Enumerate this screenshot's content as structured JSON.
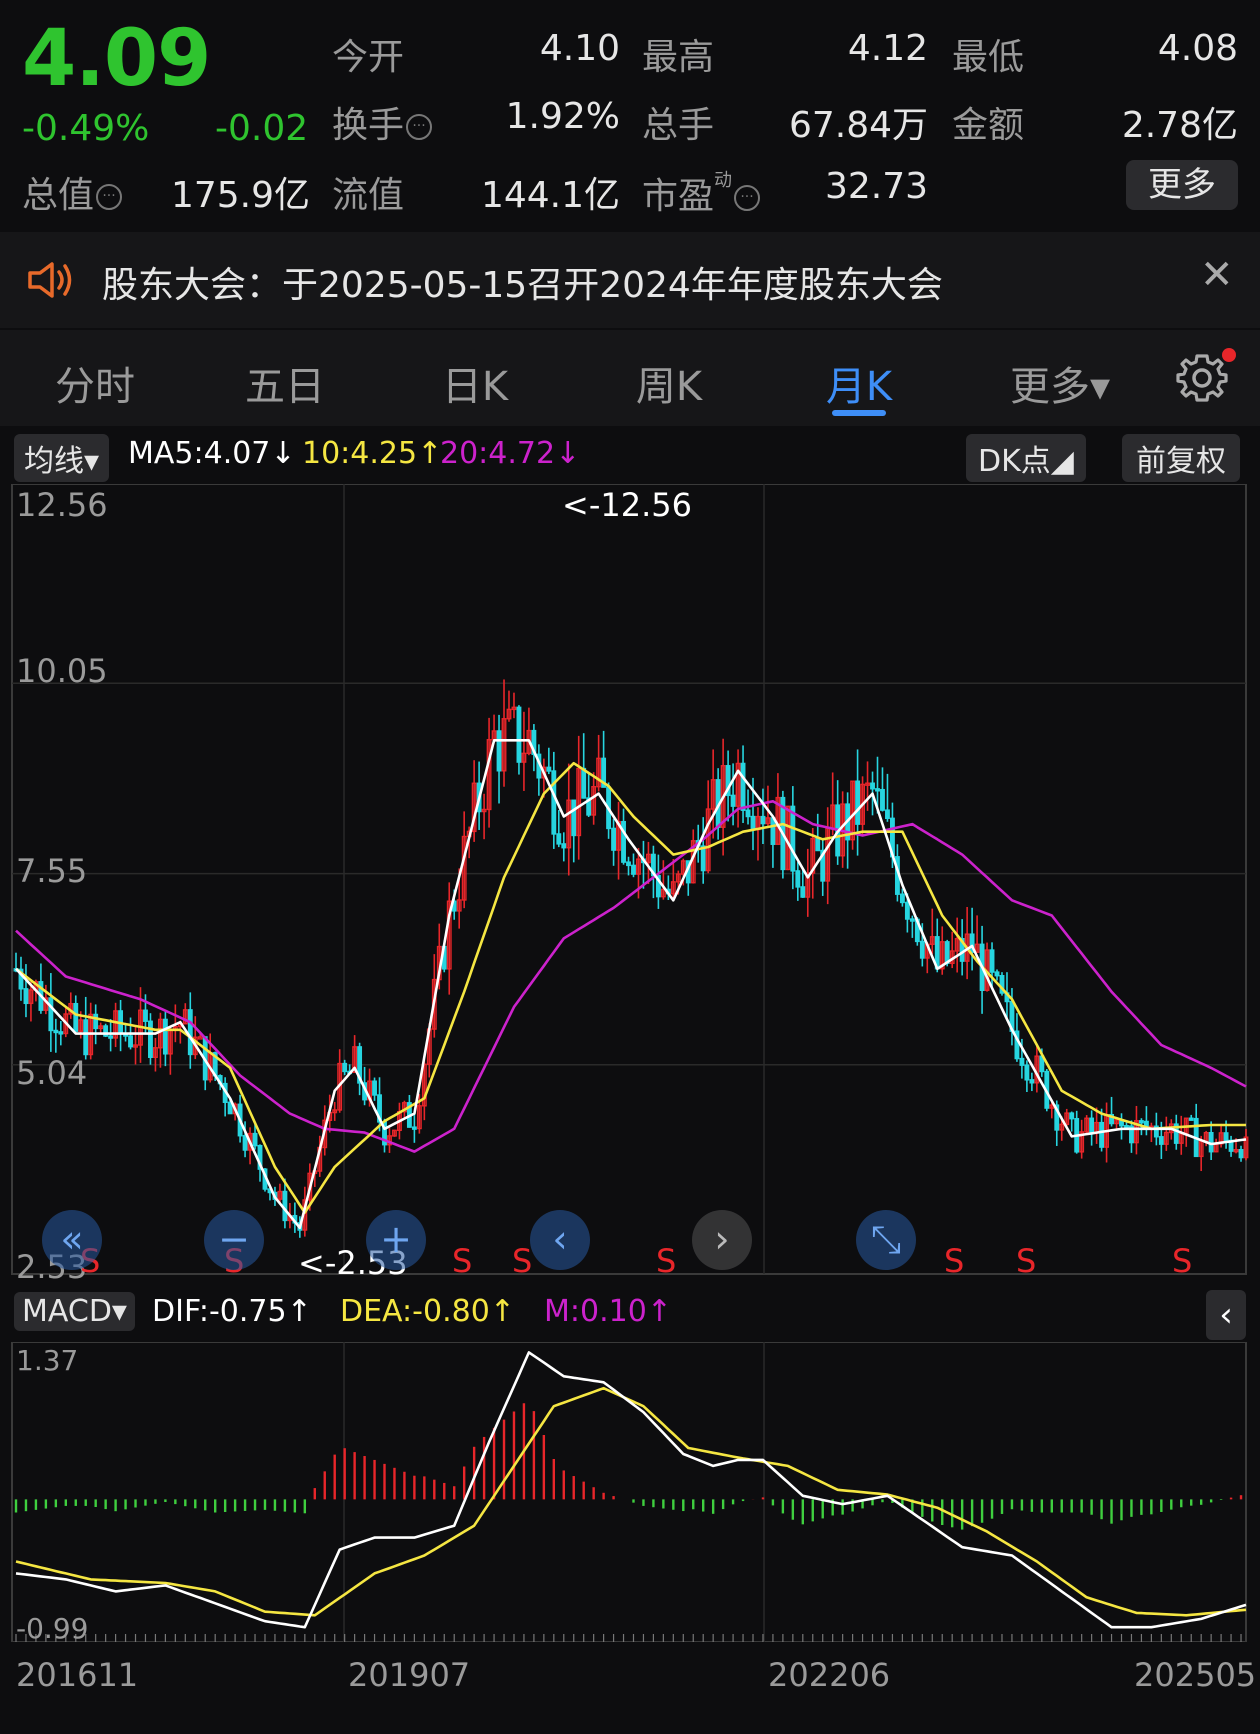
{
  "quote": {
    "price": "4.09",
    "change_pct": "-0.49%",
    "change": "-0.02",
    "open_label": "今开",
    "open": "4.10",
    "high_label": "最高",
    "high": "4.12",
    "low_label": "最低",
    "low": "4.08",
    "turnover_label": "换手",
    "turnover": "1.92%",
    "volume_label": "总手",
    "volume": "67.84万",
    "amount_label": "金额",
    "amount": "2.78亿",
    "mktcap_label": "总值",
    "mktcap": "175.9亿",
    "float_label": "流值",
    "float": "144.1亿",
    "pe_label": "市盈",
    "pe_sup": "动",
    "pe": "32.73",
    "more_label": "更多"
  },
  "notice": {
    "text": "股东大会：于2025-05-15召开2024年年度股东大会",
    "close": "✕"
  },
  "tabs": [
    {
      "label": "分时"
    },
    {
      "label": "五日"
    },
    {
      "label": "日K"
    },
    {
      "label": "周K"
    },
    {
      "label": "月K"
    },
    {
      "label": "更多▾"
    }
  ],
  "ma_bar": {
    "selector": "均线▾",
    "ma5": "MA5:4.07↓",
    "ma10": "10:4.25↑",
    "ma20": "20:4.72↓",
    "dk": "DK点◢",
    "adjust": "前复权"
  },
  "kline_axis": {
    "y_labels": [
      "12.56",
      "10.05",
      "7.55",
      "5.04",
      "2.53"
    ],
    "max_marker": "<-12.56",
    "min_marker": "<-2.53",
    "s_label": "S"
  },
  "macd_bar": {
    "selector": "MACD▾",
    "dif": "DIF:-0.75↑",
    "dea": "DEA:-0.80↑",
    "m": "M:0.10↑",
    "y_max": "1.37",
    "y_min": "-0.99"
  },
  "x_axis": [
    "201611",
    "201907",
    "202206",
    "202505"
  ],
  "colors": {
    "up": "#e8262a",
    "down": "#27d5e0",
    "ma5": "#ffffff",
    "ma10": "#f5e642",
    "ma20": "#cc22cc",
    "accent": "#3e8ef7"
  },
  "chart_data": {
    "type": "candlestick",
    "y_range": [
      2.53,
      12.56
    ],
    "ma5_knots": [
      [
        0,
        6.3
      ],
      [
        12,
        5.45
      ],
      [
        28,
        5.45
      ],
      [
        33,
        5.6
      ],
      [
        43,
        4.6
      ],
      [
        52,
        3.3
      ],
      [
        57,
        2.9
      ],
      [
        64,
        4.7
      ],
      [
        68,
        5.0
      ],
      [
        74,
        4.2
      ],
      [
        80,
        4.4
      ],
      [
        87,
        7.0
      ],
      [
        96,
        9.3
      ],
      [
        103,
        9.3
      ],
      [
        110,
        8.3
      ],
      [
        117,
        8.6
      ],
      [
        123,
        8.0
      ],
      [
        132,
        7.2
      ],
      [
        139,
        8.2
      ],
      [
        145,
        8.9
      ],
      [
        152,
        8.3
      ],
      [
        159,
        7.5
      ],
      [
        165,
        8.1
      ],
      [
        172,
        8.6
      ],
      [
        178,
        7.4
      ],
      [
        185,
        6.3
      ],
      [
        192,
        6.6
      ],
      [
        200,
        5.5
      ],
      [
        212,
        4.1
      ],
      [
        222,
        4.2
      ],
      [
        232,
        4.2
      ],
      [
        240,
        4.0
      ],
      [
        248,
        4.07
      ]
    ],
    "ma10_knots": [
      [
        0,
        6.3
      ],
      [
        12,
        5.7
      ],
      [
        28,
        5.5
      ],
      [
        33,
        5.5
      ],
      [
        43,
        5.0
      ],
      [
        52,
        3.7
      ],
      [
        58,
        3.1
      ],
      [
        64,
        3.7
      ],
      [
        74,
        4.3
      ],
      [
        82,
        4.6
      ],
      [
        90,
        6.0
      ],
      [
        98,
        7.5
      ],
      [
        106,
        8.6
      ],
      [
        112,
        9.0
      ],
      [
        119,
        8.7
      ],
      [
        124,
        8.3
      ],
      [
        132,
        7.8
      ],
      [
        139,
        7.9
      ],
      [
        146,
        8.1
      ],
      [
        154,
        8.2
      ],
      [
        162,
        8.0
      ],
      [
        170,
        8.1
      ],
      [
        178,
        8.1
      ],
      [
        186,
        7.0
      ],
      [
        193,
        6.4
      ],
      [
        200,
        5.9
      ],
      [
        210,
        4.7
      ],
      [
        218,
        4.4
      ],
      [
        228,
        4.2
      ],
      [
        240,
        4.25
      ],
      [
        248,
        4.25
      ]
    ],
    "ma20_knots": [
      [
        0,
        6.8
      ],
      [
        10,
        6.2
      ],
      [
        25,
        5.9
      ],
      [
        35,
        5.6
      ],
      [
        45,
        4.9
      ],
      [
        55,
        4.4
      ],
      [
        62,
        4.2
      ],
      [
        70,
        4.15
      ],
      [
        80,
        3.9
      ],
      [
        88,
        4.2
      ],
      [
        100,
        5.8
      ],
      [
        110,
        6.7
      ],
      [
        120,
        7.1
      ],
      [
        130,
        7.6
      ],
      [
        138,
        8.0
      ],
      [
        145,
        8.4
      ],
      [
        152,
        8.5
      ],
      [
        160,
        8.2
      ],
      [
        170,
        8.05
      ],
      [
        180,
        8.2
      ],
      [
        190,
        7.8
      ],
      [
        200,
        7.2
      ],
      [
        208,
        7.0
      ],
      [
        220,
        6.0
      ],
      [
        230,
        5.3
      ],
      [
        240,
        5.0
      ],
      [
        248,
        4.72
      ]
    ],
    "candle_months": 248,
    "macd": {
      "y_range": [
        -0.99,
        1.37
      ],
      "dif_knots": [
        [
          0,
          -0.5
        ],
        [
          10,
          -0.55
        ],
        [
          20,
          -0.65
        ],
        [
          30,
          -0.6
        ],
        [
          40,
          -0.75
        ],
        [
          50,
          -0.9
        ],
        [
          58,
          -0.95
        ],
        [
          65,
          -0.3
        ],
        [
          72,
          -0.2
        ],
        [
          80,
          -0.2
        ],
        [
          88,
          -0.1
        ],
        [
          95,
          0.6
        ],
        [
          103,
          1.35
        ],
        [
          110,
          1.15
        ],
        [
          118,
          1.1
        ],
        [
          126,
          0.85
        ],
        [
          134,
          0.5
        ],
        [
          140,
          0.4
        ],
        [
          145,
          0.45
        ],
        [
          150,
          0.45
        ],
        [
          158,
          0.15
        ],
        [
          166,
          0.08
        ],
        [
          175,
          0.15
        ],
        [
          182,
          -0.05
        ],
        [
          190,
          -0.28
        ],
        [
          200,
          -0.35
        ],
        [
          210,
          -0.65
        ],
        [
          220,
          -0.95
        ],
        [
          228,
          -0.95
        ],
        [
          238,
          -0.88
        ],
        [
          248,
          -0.75
        ]
      ],
      "dea_knots": [
        [
          0,
          -0.4
        ],
        [
          15,
          -0.55
        ],
        [
          30,
          -0.58
        ],
        [
          40,
          -0.65
        ],
        [
          50,
          -0.82
        ],
        [
          60,
          -0.85
        ],
        [
          72,
          -0.5
        ],
        [
          82,
          -0.35
        ],
        [
          92,
          -0.1
        ],
        [
          100,
          0.4
        ],
        [
          108,
          0.9
        ],
        [
          118,
          1.05
        ],
        [
          126,
          0.9
        ],
        [
          135,
          0.55
        ],
        [
          145,
          0.47
        ],
        [
          155,
          0.4
        ],
        [
          165,
          0.2
        ],
        [
          175,
          0.16
        ],
        [
          185,
          0.05
        ],
        [
          195,
          -0.15
        ],
        [
          205,
          -0.4
        ],
        [
          215,
          -0.7
        ],
        [
          225,
          -0.83
        ],
        [
          235,
          -0.85
        ],
        [
          248,
          -0.8
        ]
      ]
    }
  }
}
